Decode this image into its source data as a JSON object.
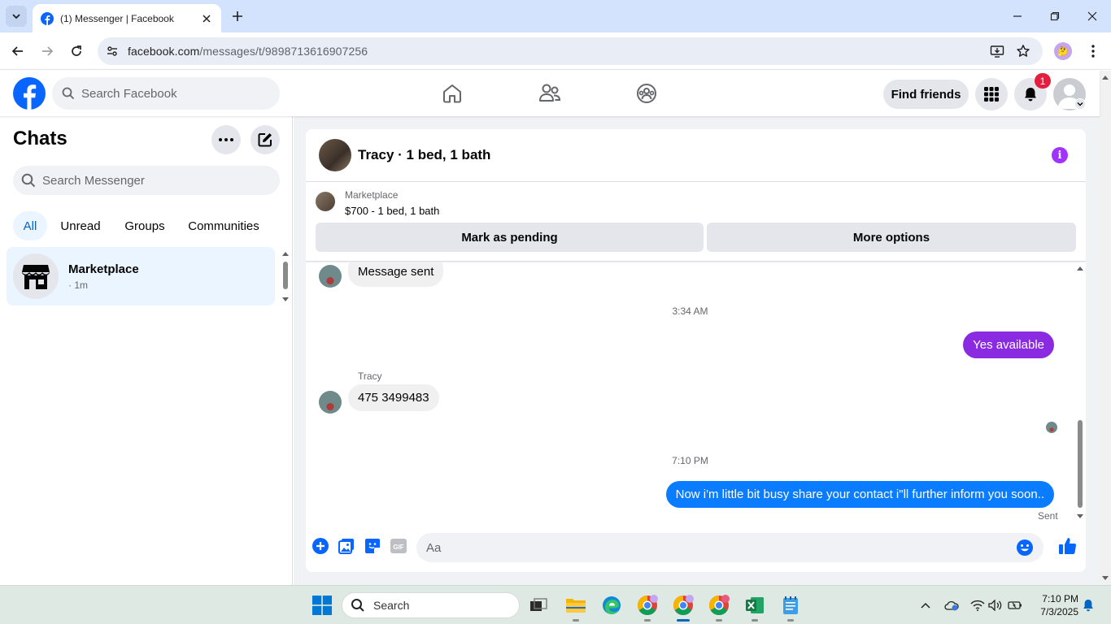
{
  "browser": {
    "tab_title": "(1) Messenger | Facebook",
    "url_host": "facebook.com",
    "url_path": "/messages/t/9898713616907256"
  },
  "facebook": {
    "search_placeholder": "Search Facebook",
    "find_friends_label": "Find friends",
    "notification_count": "1",
    "brand_color": "#0866ff"
  },
  "chats": {
    "title": "Chats",
    "search_placeholder": "Search Messenger",
    "filters": [
      "All",
      "Unread",
      "Groups",
      "Communities"
    ],
    "active_filter": "All",
    "items": [
      {
        "name": "Marketplace",
        "time": "· 1m"
      }
    ]
  },
  "conversation": {
    "title": "Tracy · 1 bed, 1 bath",
    "marketplace": {
      "label": "Marketplace",
      "listing": "$700 - 1 bed, 1 bath",
      "mark_pending_label": "Mark as pending",
      "more_options_label": "More options"
    },
    "messages": {
      "msg1": "Message sent",
      "time1": "3:34 AM",
      "msg2": "Yes available",
      "sender": "Tracy",
      "msg3": "475 3499483",
      "time2": "7:10 PM",
      "msg4": "Now i'm little bit busy share your contact i\"ll further inform you soon..",
      "status": "Sent"
    },
    "composer_placeholder": "Aa",
    "outgoing_color_purple": "#8a2be2",
    "outgoing_color_blue": "#0a7cff"
  },
  "taskbar": {
    "search_label": "Search",
    "time": "7:10 PM",
    "date": "7/3/2025"
  }
}
